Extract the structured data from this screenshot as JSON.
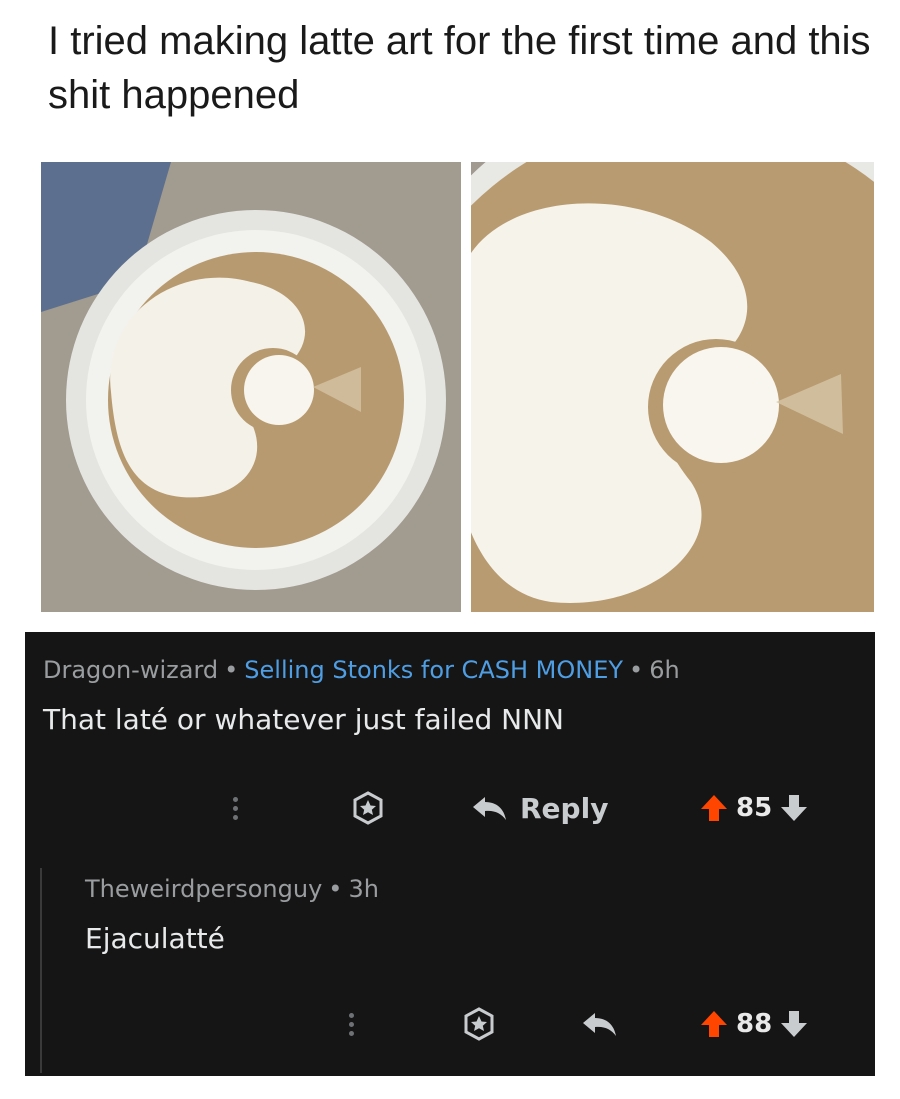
{
  "post": {
    "caption": "I tried making latte art for the first time and this shit happened"
  },
  "comments": [
    {
      "author": "Dragon-wizard",
      "flair": "Selling Stonks for CASH MONEY",
      "age": "6h",
      "text": "That laté or whatever just failed NNN",
      "reply_label": "Reply",
      "score": "85"
    },
    {
      "author": "Theweirdpersonguy",
      "age": "3h",
      "text": "Ejaculatté",
      "score": "88"
    }
  ],
  "colors": {
    "flair": "#4f9ee4",
    "upvote": "#ff4500",
    "background": "#151515"
  },
  "icons": [
    "more-vertical-icon",
    "award-icon",
    "reply-arrow-icon",
    "upvote-arrow-icon",
    "downvote-arrow-icon"
  ]
}
